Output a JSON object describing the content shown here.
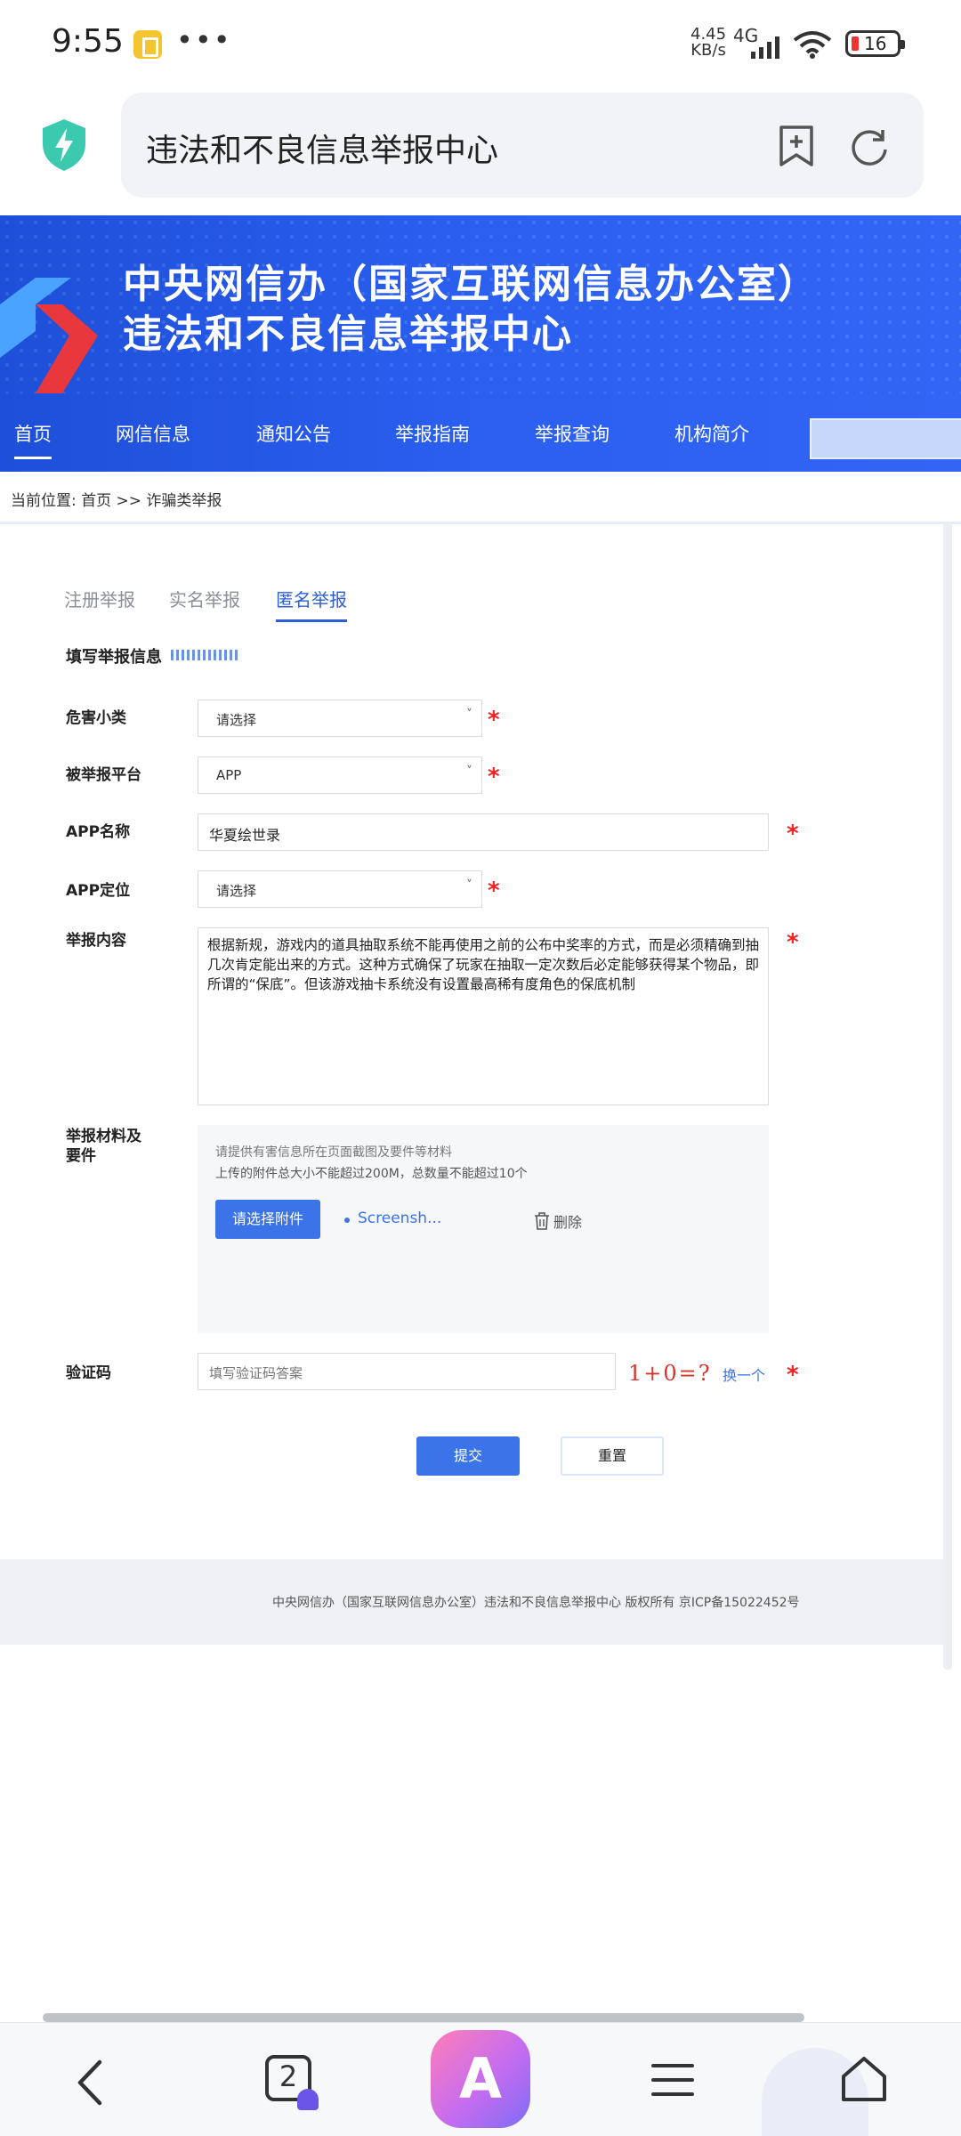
{
  "status_bar": {
    "time": "9:55",
    "dots": "•••",
    "net_speed_value": "4.45",
    "net_speed_unit": "KB/s",
    "network": "4G",
    "battery": "16"
  },
  "browser": {
    "url_title": "违法和不良信息举报中心"
  },
  "banner": {
    "title_line1": "中央网信办（国家互联网信息办公室）",
    "title_line2": "违法和不良信息举报中心",
    "nav": [
      "首页",
      "网信信息",
      "通知公告",
      "举报指南",
      "举报查询",
      "机构简介"
    ]
  },
  "breadcrumb": "当前位置: 首页 >> 诈骗类举报",
  "tabs": [
    "注册举报",
    "实名举报",
    "匿名举报"
  ],
  "section_title": "填写举报信息",
  "form": {
    "harm_type_label": "危害小类",
    "harm_type_value": "请选择",
    "platform_label": "被举报平台",
    "platform_value": "APP",
    "app_name_label": "APP名称",
    "app_name_value": "华夏绘世录",
    "app_position_label": "APP定位",
    "app_position_value": "请选择",
    "content_label": "举报内容",
    "content_value": "根据新规，游戏内的道具抽取系统不能再使用之前的公布中奖率的方式，而是必须精确到抽几次肯定能出来的方式。这种方式确保了玩家在抽取一定次数后必定能够获得某个物品，即所谓的“保底”。但该游戏抽卡系统没有设置最高稀有度角色的保底机制",
    "materials_label_1": "举报材料及",
    "materials_label_2": "要件",
    "upload_hint_1": "请提供有害信息所在页面截图及要件等材料",
    "upload_hint_2": "上传的附件总大小不能超过200M，总数量不能超过10个",
    "upload_button": "请选择附件",
    "file_name": "Screensh...",
    "delete_label": "删除",
    "captcha_label": "验证码",
    "captcha_placeholder": "填写验证码答案",
    "captcha_image_text": "1+0=?",
    "captcha_refresh": "换一个",
    "required_mark": "*",
    "submit": "提交",
    "reset": "重置"
  },
  "footer": "中央网信办（国家互联网信息办公室）违法和不良信息举报中心 版权所有 京ICP备15022452号",
  "bottom_nav": {
    "tab_count": "2",
    "app_logo_letter": "A"
  },
  "colors": {
    "brand_blue": "#2a5ff0",
    "button_blue": "#3a74e8",
    "required_red": "#e22222"
  }
}
